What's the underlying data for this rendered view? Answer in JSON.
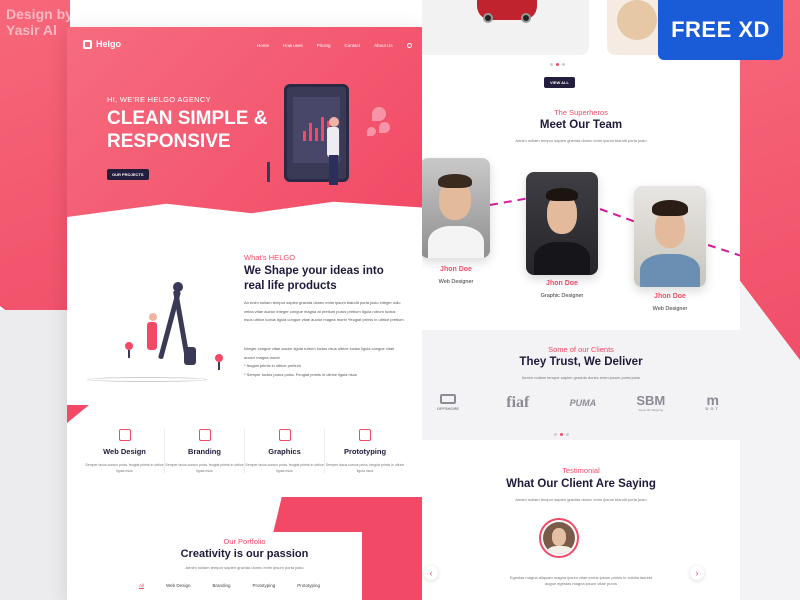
{
  "overlay": {
    "credit": "Design by\nYasir Al",
    "badge": "FREE XD"
  },
  "left_page": {
    "logo": "Helgo",
    "nav": [
      "Home",
      "How uses",
      "Pricing",
      "Contact",
      "About Us"
    ],
    "hero": {
      "eyebrow": "HI, WE'RE HELGO AGENCY",
      "title": "CLEAN SIMPLE & RESPONSIVE",
      "button": "OUR PROJECTS"
    },
    "about": {
      "eyebrow": "What's HELGO",
      "title": "We Shape your ideas into real life products",
      "text": "An enim nullam tempor sapien gravida donec enim ipsum blandit porta justo integer odio velna vitae auctor integer congue magna at pretium purus pretium ligula rutrum luctus risus ultrice luctus ligula congue vitae auctor magna morbi *feugiat primis in ultrice pretium",
      "text2": "Integer congue vitae auctor ligula rutrum luctus risus ultrice luctus ligula congue vitae auctor magna morbi\n* feugiat primis in ultrice pretium\n* Semper luctus purus porta. Feugiat primis in ultrice ligula risus"
    },
    "services": [
      {
        "icon": "design-icon",
        "title": "Web Design",
        "desc": "Semper lacus cursus porta, feugiat primis in ultrice ligula risus"
      },
      {
        "icon": "branding-icon",
        "title": "Branding",
        "desc": "Semper lacus cursus porta, feugiat primis in ultrice ligula risus"
      },
      {
        "icon": "graphics-icon",
        "title": "Graphics",
        "desc": "Semper lacus cursus porta, feugiat primis in ultrice ligula risus"
      },
      {
        "icon": "prototyping-icon",
        "title": "Prototyping",
        "desc": "Semper lacus cursus porta, feugiat primis in ultrice ligula risus"
      }
    ],
    "portfolio": {
      "eyebrow": "Our Portfolio",
      "title": "Creativity is our passion",
      "sub": "Aenim nullam tempor sapien gravida donec enim ipsum porta justo",
      "tabs": [
        "All",
        "Web Design",
        "Branding",
        "Prototyping",
        "Prototyping"
      ]
    }
  },
  "right_page": {
    "view_all": "VIEW ALL",
    "team": {
      "eyebrow": "The Superheros",
      "title": "Meet Our Team",
      "sub": "Aenim nullam tempor sapien gravida donec enim ipsum blandit porta justo",
      "members": [
        {
          "name": "Jhon Doe",
          "role": "Web Designer"
        },
        {
          "name": "Jhon Doe",
          "role": "Graphic Designer"
        },
        {
          "name": "Jhon Doe",
          "role": "Web Designer"
        }
      ]
    },
    "clients": {
      "eyebrow": "Some of our Clients",
      "title": "They Trust, We Deliver",
      "sub": "Aenim nullam tempor sapien gravida donec enim ipsum porta justo",
      "logos": [
        {
          "name": "OFFSHORE"
        },
        {
          "name": "fiaf"
        },
        {
          "name": "PUMA"
        },
        {
          "name": "SBM",
          "sub": "Super Bit Mapping"
        },
        {
          "name": "m",
          "sub": "DOT"
        }
      ]
    },
    "testimonial": {
      "eyebrow": "Testimonial",
      "title": "What Our Client Are Saying",
      "sub": "Aenim nullam tempor sapien gravida donec enim ipsum blandit porta justo",
      "quote": "Egestas magna aliquam magna ipsum vitae purus ipsum primis in cubilia laoreet augue egestas magna ipsum vitae purus",
      "prev": "‹",
      "next": "›"
    }
  },
  "colors": {
    "accent": "#f24a66",
    "dark": "#231e3d",
    "badge": "#1a5cd8"
  }
}
